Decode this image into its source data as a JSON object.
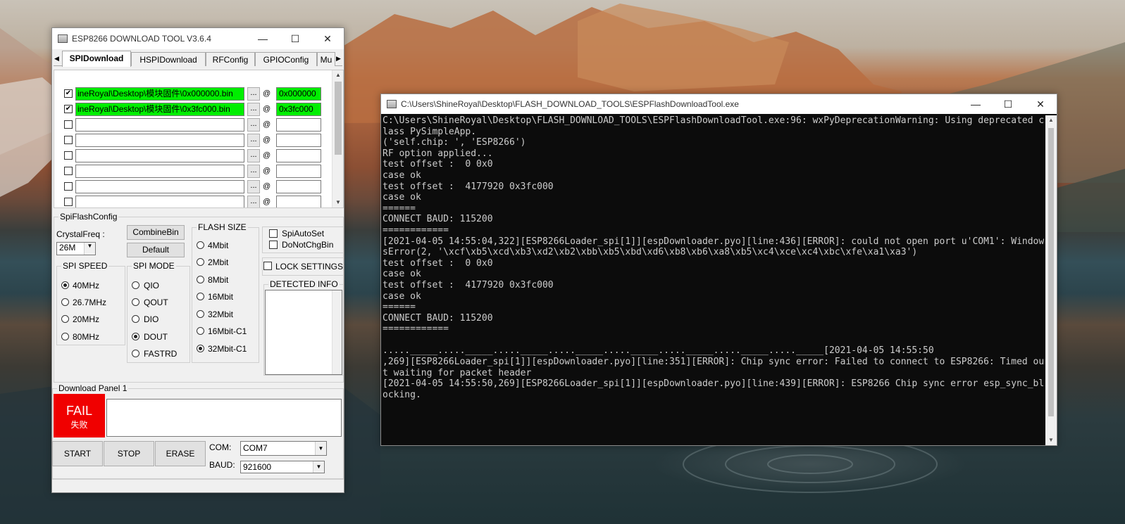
{
  "esp_window": {
    "title": "ESP8266 DOWNLOAD TOOL V3.6.4",
    "controls": {
      "minimize": "—",
      "maximize": "☐",
      "close": "✕"
    },
    "tabs": [
      "SPIDownload",
      "HSPIDownload",
      "RFConfig",
      "GPIOConfig",
      "Mu"
    ],
    "tab_scroll_left": "◀",
    "tab_scroll_right": "▶",
    "file_rows": [
      {
        "checked": true,
        "path": "ineRoyal\\Desktop\\模块固件\\0x000000.bin",
        "address": "0x000000",
        "highlight": true
      },
      {
        "checked": true,
        "path": "ineRoyal\\Desktop\\模块固件\\0x3fc000.bin",
        "address": "0x3fc000",
        "highlight": true
      },
      {
        "checked": false,
        "path": "",
        "address": "",
        "highlight": false
      },
      {
        "checked": false,
        "path": "",
        "address": "",
        "highlight": false
      },
      {
        "checked": false,
        "path": "",
        "address": "",
        "highlight": false
      },
      {
        "checked": false,
        "path": "",
        "address": "",
        "highlight": false
      },
      {
        "checked": false,
        "path": "",
        "address": "",
        "highlight": false
      },
      {
        "checked": false,
        "path": "",
        "address": "",
        "highlight": false
      }
    ],
    "browse_label": "...",
    "at_label": "@",
    "check_mark": "✔",
    "spi_flash_config": {
      "title": "SpiFlashConfig",
      "crystal_freq_label": "CrystalFreq :",
      "crystal_freq_value": "26M",
      "combine_bin_label": "CombineBin",
      "default_label": "Default",
      "spi_speed": {
        "title": "SPI SPEED",
        "options": [
          "40MHz",
          "26.7MHz",
          "20MHz",
          "80MHz"
        ],
        "selected": 0
      },
      "spi_mode": {
        "title": "SPI MODE",
        "options": [
          "QIO",
          "QOUT",
          "DIO",
          "DOUT",
          "FASTRD"
        ],
        "selected": 3
      },
      "flash_size": {
        "title": "FLASH SIZE",
        "options": [
          "4Mbit",
          "2Mbit",
          "8Mbit",
          "16Mbit",
          "32Mbit",
          "16Mbit-C1",
          "32Mbit-C1"
        ],
        "selected": 6
      },
      "spi_auto_set_label": "SpiAutoSet",
      "do_not_chg_bin_label": "DoNotChgBin",
      "lock_settings_label": "LOCK SETTINGS",
      "detected_info_label": "DETECTED INFO"
    },
    "download_panel": {
      "title": "Download Panel 1",
      "status": "FAIL",
      "status_cn": "失败",
      "start_label": "START",
      "stop_label": "STOP",
      "erase_label": "ERASE",
      "com_label": "COM:",
      "com_value": "COM7",
      "baud_label": "BAUD:",
      "baud_value": "921600"
    }
  },
  "console_window": {
    "title": "C:\\Users\\ShineRoyal\\Desktop\\FLASH_DOWNLOAD_TOOLS\\ESPFlashDownloadTool.exe",
    "controls": {
      "minimize": "—",
      "maximize": "☐",
      "close": "✕"
    },
    "lines": [
      "C:\\Users\\ShineRoyal\\Desktop\\FLASH_DOWNLOAD_TOOLS\\ESPFlashDownloadTool.exe:96: wxPyDeprecationWarning: Using deprecated c",
      "lass PySimpleApp.",
      "('self.chip: ', 'ESP8266')",
      "RF option applied...",
      "test offset :  0 0x0",
      "case ok",
      "test offset :  4177920 0x3fc000",
      "case ok",
      "======",
      "CONNECT BAUD: 115200",
      "============",
      "[2021-04-05 14:55:04,322][ESP8266Loader_spi[1]][espDownloader.pyo][line:436][ERROR]: could not open port u'COM1': Window",
      "sError(2, '\\xcf\\xb5\\xcd\\xb3\\xd2\\xb2\\xbb\\xb5\\xbd\\xd6\\xb8\\xb6\\xa8\\xb5\\xc4\\xce\\xc4\\xbc\\xfe\\xa1\\xa3')",
      "test offset :  0 0x0",
      "case ok",
      "test offset :  4177920 0x3fc000",
      "case ok",
      "======",
      "CONNECT BAUD: 115200",
      "============",
      "",
      "....._____....._____....._____....._____....._____....._____....._____....._____[2021-04-05 14:55:50",
      ",269][ESP8266Loader_spi[1]][espDownloader.pyo][line:351][ERROR]: Chip sync error: Failed to connect to ESP8266: Timed ou",
      "t waiting for packet header",
      "[2021-04-05 14:55:50,269][ESP8266Loader_spi[1]][espDownloader.pyo][line:439][ERROR]: ESP8266 Chip sync error esp_sync_bl",
      "ocking."
    ]
  }
}
